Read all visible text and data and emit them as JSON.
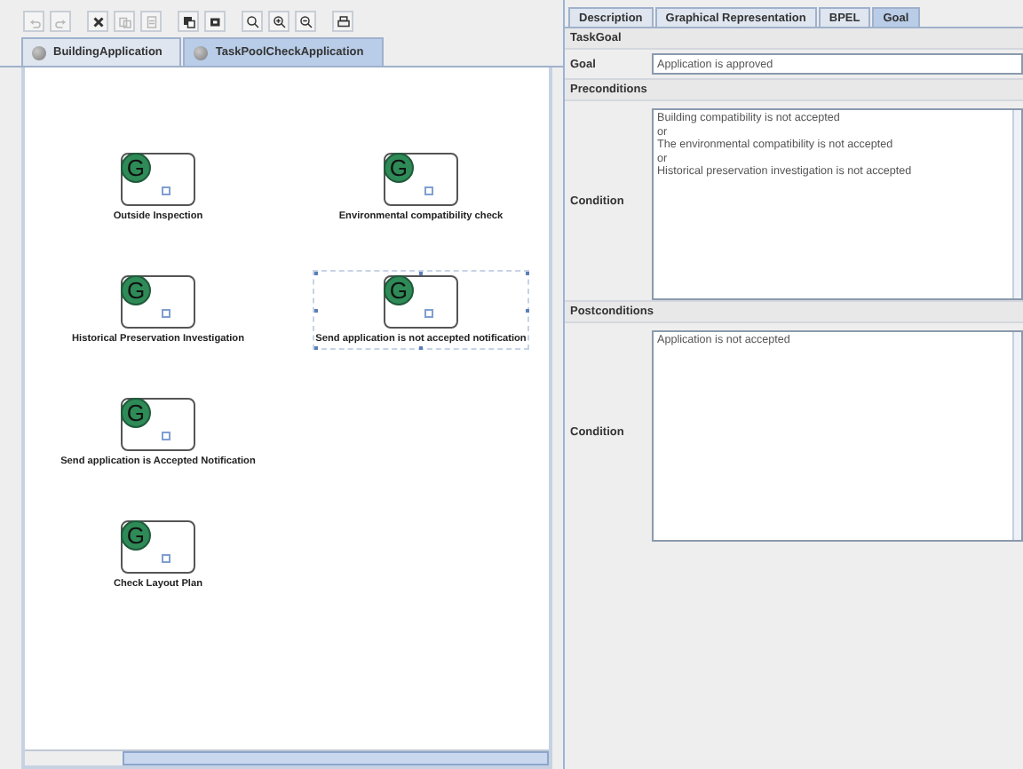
{
  "toolbar": [
    {
      "kind": "undo",
      "disabled": true
    },
    {
      "kind": "redo",
      "disabled": true
    },
    {
      "kind": "delete",
      "disabled": false
    },
    {
      "kind": "copy",
      "disabled": true
    },
    {
      "kind": "paste",
      "disabled": true
    },
    {
      "kind": "back",
      "disabled": false
    },
    {
      "kind": "front",
      "disabled": false
    },
    {
      "kind": "zoom",
      "disabled": false
    },
    {
      "kind": "zoom-in",
      "disabled": false
    },
    {
      "kind": "zoom-out",
      "disabled": false
    },
    {
      "kind": "print",
      "disabled": false
    }
  ],
  "editor_tabs": [
    {
      "label": "BuildingApplication",
      "selected": false
    },
    {
      "label": "TaskPoolCheckApplication",
      "selected": true
    }
  ],
  "nodes": [
    {
      "letter": "G",
      "label": "Outside Inspection",
      "selected": false
    },
    {
      "letter": "G",
      "label": "Environmental compatibility check",
      "selected": false
    },
    {
      "letter": "G",
      "label": "Historical Preservation Investigation",
      "selected": false
    },
    {
      "letter": "G",
      "label": "Send application is not accepted notification",
      "selected": true
    },
    {
      "letter": "G",
      "label": "Send application is Accepted Notification",
      "selected": false
    },
    {
      "letter": "G",
      "label": "Check Layout Plan",
      "selected": false
    }
  ],
  "property_tabs": [
    {
      "label": "Description",
      "selected": false
    },
    {
      "label": "Graphical Representation",
      "selected": false
    },
    {
      "label": "BPEL",
      "selected": false
    },
    {
      "label": "Goal",
      "selected": true
    }
  ],
  "task_goal": {
    "title": "TaskGoal",
    "label": "Goal",
    "value": "Application is approved"
  },
  "preconditions": {
    "title": "Preconditions",
    "label": "Condition",
    "lines": [
      "Building compatibility is not accepted",
      "or",
      "The environmental compatibility is not accepted",
      "or",
      "Historical preservation investigation is not accepted"
    ]
  },
  "postconditions": {
    "title": "Postconditions",
    "label": "Condition",
    "lines": [
      "Application is not accepted"
    ]
  }
}
